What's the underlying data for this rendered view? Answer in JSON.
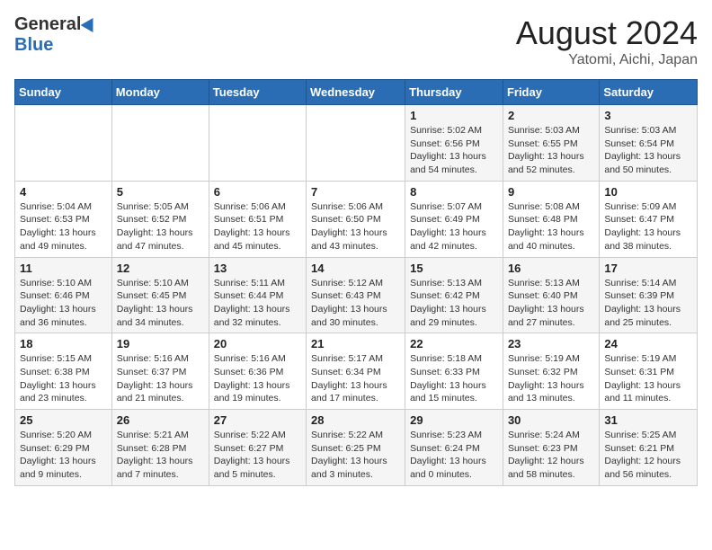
{
  "logo": {
    "general": "General",
    "blue": "Blue"
  },
  "header": {
    "title": "August 2024",
    "subtitle": "Yatomi, Aichi, Japan"
  },
  "weekdays": [
    "Sunday",
    "Monday",
    "Tuesday",
    "Wednesday",
    "Thursday",
    "Friday",
    "Saturday"
  ],
  "weeks": [
    [
      {
        "day": "",
        "info": ""
      },
      {
        "day": "",
        "info": ""
      },
      {
        "day": "",
        "info": ""
      },
      {
        "day": "",
        "info": ""
      },
      {
        "day": "1",
        "info": "Sunrise: 5:02 AM\nSunset: 6:56 PM\nDaylight: 13 hours\nand 54 minutes."
      },
      {
        "day": "2",
        "info": "Sunrise: 5:03 AM\nSunset: 6:55 PM\nDaylight: 13 hours\nand 52 minutes."
      },
      {
        "day": "3",
        "info": "Sunrise: 5:03 AM\nSunset: 6:54 PM\nDaylight: 13 hours\nand 50 minutes."
      }
    ],
    [
      {
        "day": "4",
        "info": "Sunrise: 5:04 AM\nSunset: 6:53 PM\nDaylight: 13 hours\nand 49 minutes."
      },
      {
        "day": "5",
        "info": "Sunrise: 5:05 AM\nSunset: 6:52 PM\nDaylight: 13 hours\nand 47 minutes."
      },
      {
        "day": "6",
        "info": "Sunrise: 5:06 AM\nSunset: 6:51 PM\nDaylight: 13 hours\nand 45 minutes."
      },
      {
        "day": "7",
        "info": "Sunrise: 5:06 AM\nSunset: 6:50 PM\nDaylight: 13 hours\nand 43 minutes."
      },
      {
        "day": "8",
        "info": "Sunrise: 5:07 AM\nSunset: 6:49 PM\nDaylight: 13 hours\nand 42 minutes."
      },
      {
        "day": "9",
        "info": "Sunrise: 5:08 AM\nSunset: 6:48 PM\nDaylight: 13 hours\nand 40 minutes."
      },
      {
        "day": "10",
        "info": "Sunrise: 5:09 AM\nSunset: 6:47 PM\nDaylight: 13 hours\nand 38 minutes."
      }
    ],
    [
      {
        "day": "11",
        "info": "Sunrise: 5:10 AM\nSunset: 6:46 PM\nDaylight: 13 hours\nand 36 minutes."
      },
      {
        "day": "12",
        "info": "Sunrise: 5:10 AM\nSunset: 6:45 PM\nDaylight: 13 hours\nand 34 minutes."
      },
      {
        "day": "13",
        "info": "Sunrise: 5:11 AM\nSunset: 6:44 PM\nDaylight: 13 hours\nand 32 minutes."
      },
      {
        "day": "14",
        "info": "Sunrise: 5:12 AM\nSunset: 6:43 PM\nDaylight: 13 hours\nand 30 minutes."
      },
      {
        "day": "15",
        "info": "Sunrise: 5:13 AM\nSunset: 6:42 PM\nDaylight: 13 hours\nand 29 minutes."
      },
      {
        "day": "16",
        "info": "Sunrise: 5:13 AM\nSunset: 6:40 PM\nDaylight: 13 hours\nand 27 minutes."
      },
      {
        "day": "17",
        "info": "Sunrise: 5:14 AM\nSunset: 6:39 PM\nDaylight: 13 hours\nand 25 minutes."
      }
    ],
    [
      {
        "day": "18",
        "info": "Sunrise: 5:15 AM\nSunset: 6:38 PM\nDaylight: 13 hours\nand 23 minutes."
      },
      {
        "day": "19",
        "info": "Sunrise: 5:16 AM\nSunset: 6:37 PM\nDaylight: 13 hours\nand 21 minutes."
      },
      {
        "day": "20",
        "info": "Sunrise: 5:16 AM\nSunset: 6:36 PM\nDaylight: 13 hours\nand 19 minutes."
      },
      {
        "day": "21",
        "info": "Sunrise: 5:17 AM\nSunset: 6:34 PM\nDaylight: 13 hours\nand 17 minutes."
      },
      {
        "day": "22",
        "info": "Sunrise: 5:18 AM\nSunset: 6:33 PM\nDaylight: 13 hours\nand 15 minutes."
      },
      {
        "day": "23",
        "info": "Sunrise: 5:19 AM\nSunset: 6:32 PM\nDaylight: 13 hours\nand 13 minutes."
      },
      {
        "day": "24",
        "info": "Sunrise: 5:19 AM\nSunset: 6:31 PM\nDaylight: 13 hours\nand 11 minutes."
      }
    ],
    [
      {
        "day": "25",
        "info": "Sunrise: 5:20 AM\nSunset: 6:29 PM\nDaylight: 13 hours\nand 9 minutes."
      },
      {
        "day": "26",
        "info": "Sunrise: 5:21 AM\nSunset: 6:28 PM\nDaylight: 13 hours\nand 7 minutes."
      },
      {
        "day": "27",
        "info": "Sunrise: 5:22 AM\nSunset: 6:27 PM\nDaylight: 13 hours\nand 5 minutes."
      },
      {
        "day": "28",
        "info": "Sunrise: 5:22 AM\nSunset: 6:25 PM\nDaylight: 13 hours\nand 3 minutes."
      },
      {
        "day": "29",
        "info": "Sunrise: 5:23 AM\nSunset: 6:24 PM\nDaylight: 13 hours\nand 0 minutes."
      },
      {
        "day": "30",
        "info": "Sunrise: 5:24 AM\nSunset: 6:23 PM\nDaylight: 12 hours\nand 58 minutes."
      },
      {
        "day": "31",
        "info": "Sunrise: 5:25 AM\nSunset: 6:21 PM\nDaylight: 12 hours\nand 56 minutes."
      }
    ]
  ]
}
